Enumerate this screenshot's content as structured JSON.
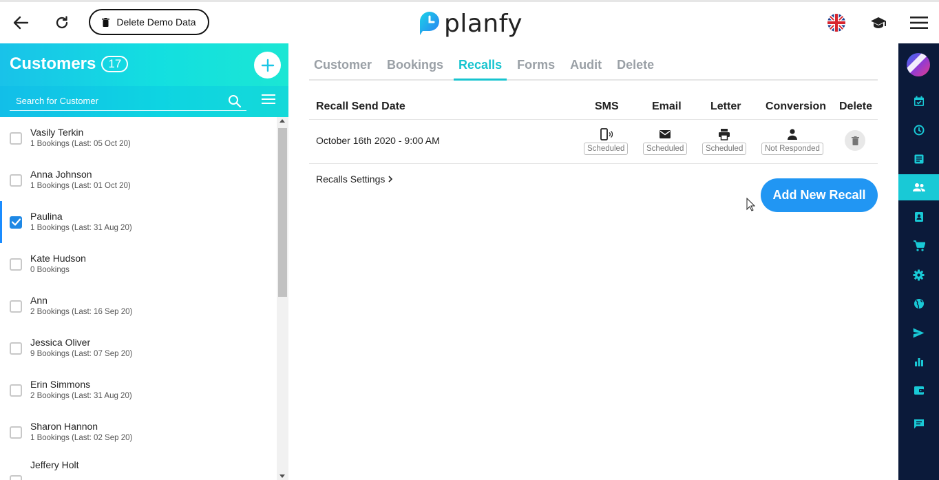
{
  "topbar": {
    "demo_button_label": "Delete Demo Data",
    "logo_text": "planfy"
  },
  "customers": {
    "title": "Customers",
    "count": "17",
    "search_placeholder": "Search for Customer",
    "items": [
      {
        "name": "Vasily Terkin",
        "sub": "1 Bookings (Last: 05 Oct 20)",
        "checked": false
      },
      {
        "name": "Anna Johnson",
        "sub": "1 Bookings (Last: 01 Oct 20)",
        "checked": false
      },
      {
        "name": "Paulina",
        "sub": "1 Bookings (Last: 31 Aug 20)",
        "checked": true
      },
      {
        "name": "Kate Hudson",
        "sub": "0 Bookings",
        "checked": false
      },
      {
        "name": "Ann",
        "sub": "2 Bookings (Last: 16 Sep 20)",
        "checked": false
      },
      {
        "name": "Jessica Oliver",
        "sub": "9 Bookings (Last: 07 Sep 20)",
        "checked": false
      },
      {
        "name": "Erin Simmons",
        "sub": "2 Bookings (Last: 31 Aug 20)",
        "checked": false
      },
      {
        "name": "Sharon Hannon",
        "sub": "1 Bookings (Last: 02 Sep 20)",
        "checked": false
      },
      {
        "name": "Jeffery Holt",
        "sub": "",
        "checked": false
      }
    ]
  },
  "tabs": [
    {
      "label": "Customer",
      "active": false
    },
    {
      "label": "Bookings",
      "active": false
    },
    {
      "label": "Recalls",
      "active": true
    },
    {
      "label": "Forms",
      "active": false
    },
    {
      "label": "Audit",
      "active": false
    },
    {
      "label": "Delete",
      "active": false
    }
  ],
  "recalls": {
    "headers": {
      "date": "Recall Send Date",
      "sms": "SMS",
      "email": "Email",
      "letter": "Letter",
      "conversion": "Conversion",
      "delete": "Delete"
    },
    "rows": [
      {
        "date": "October 16th 2020 - 9:00 AM",
        "sms": "Scheduled",
        "email": "Scheduled",
        "letter": "Scheduled",
        "conversion": "Not Responded"
      }
    ],
    "settings_link": "Recalls Settings",
    "add_button": "Add New Recall"
  },
  "right_nav": {
    "icons": [
      "calendar-check-icon",
      "clock-icon",
      "document-icon",
      "users-icon",
      "contact-card-icon",
      "cart-icon",
      "gear-icon",
      "globe-icon",
      "send-icon",
      "bar-chart-icon",
      "wallet-icon",
      "chat-icon"
    ],
    "active_index": 3
  },
  "colors": {
    "accent": "#17c4cf",
    "primary_button": "#2196f3",
    "nav_bg": "#0b1a3a"
  }
}
